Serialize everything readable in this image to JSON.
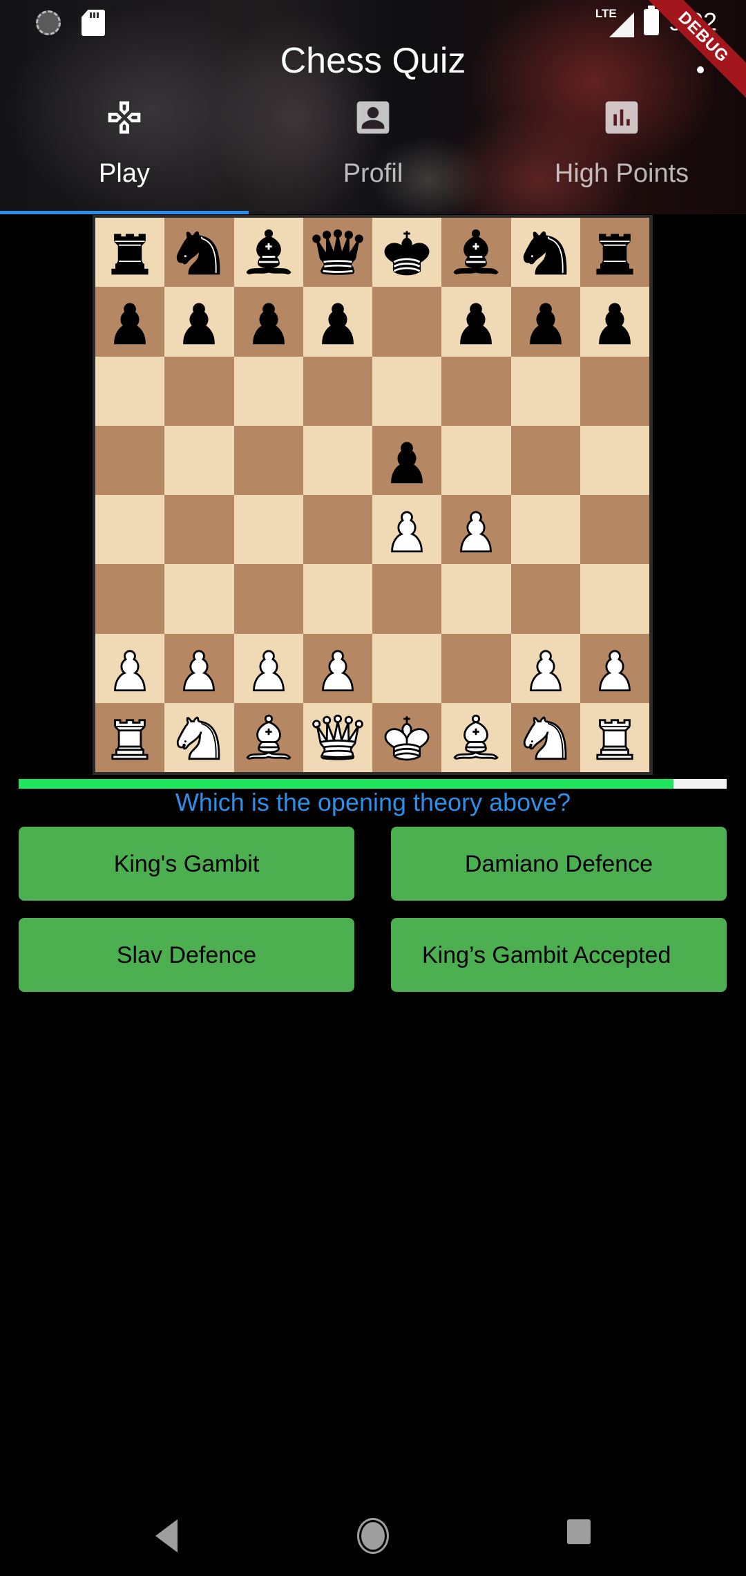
{
  "status_bar": {
    "time": "9:02",
    "network": "LTE",
    "icons": [
      "loading-icon",
      "sd-card-icon",
      "signal-icon",
      "battery-icon"
    ]
  },
  "debug_banner": "DEBUG",
  "app_bar": {
    "title": "Chess Quiz",
    "menu_icon": "more-vert-icon"
  },
  "tabs": [
    {
      "label": "Play",
      "icon": "gamepad-icon",
      "active": true
    },
    {
      "label": "Profil",
      "icon": "account-box-icon",
      "active": false
    },
    {
      "label": "High Points",
      "icon": "bar-chart-icon",
      "active": false
    }
  ],
  "board": {
    "light_color": "#f0d9b5",
    "dark_color": "#b58863",
    "ranks": [
      [
        "br",
        "bn",
        "bb",
        "bq",
        "bk",
        "bb",
        "bn",
        "br"
      ],
      [
        "bp",
        "bp",
        "bp",
        "bp",
        "",
        "bp",
        "bp",
        "bp"
      ],
      [
        "",
        "",
        "",
        "",
        "",
        "",
        "",
        ""
      ],
      [
        "",
        "",
        "",
        "",
        "bp",
        "",
        "",
        ""
      ],
      [
        "",
        "",
        "",
        "",
        "wp",
        "wp",
        "",
        ""
      ],
      [
        "",
        "",
        "",
        "",
        "",
        "",
        "",
        ""
      ],
      [
        "wp",
        "wp",
        "wp",
        "wp",
        "",
        "",
        "wp",
        "wp"
      ],
      [
        "wr",
        "wn",
        "wb",
        "wq",
        "wk",
        "wb",
        "wn",
        "wr"
      ]
    ]
  },
  "timer": {
    "progress": 0.925,
    "fill_color": "#1ee65c",
    "track_color": "#f2f2f2"
  },
  "quiz": {
    "question": "Which is the opening theory above?",
    "question_color": "#2f8ee8",
    "answers": [
      {
        "label": "King's Gambit"
      },
      {
        "label": "Damiano Defence"
      },
      {
        "label": "Slav Defence"
      },
      {
        "label": "King’s Gambit Accepted"
      }
    ],
    "button_color": "#4caf50"
  },
  "nav_bar": {
    "buttons": [
      "back-icon",
      "home-icon",
      "recents-icon"
    ]
  }
}
